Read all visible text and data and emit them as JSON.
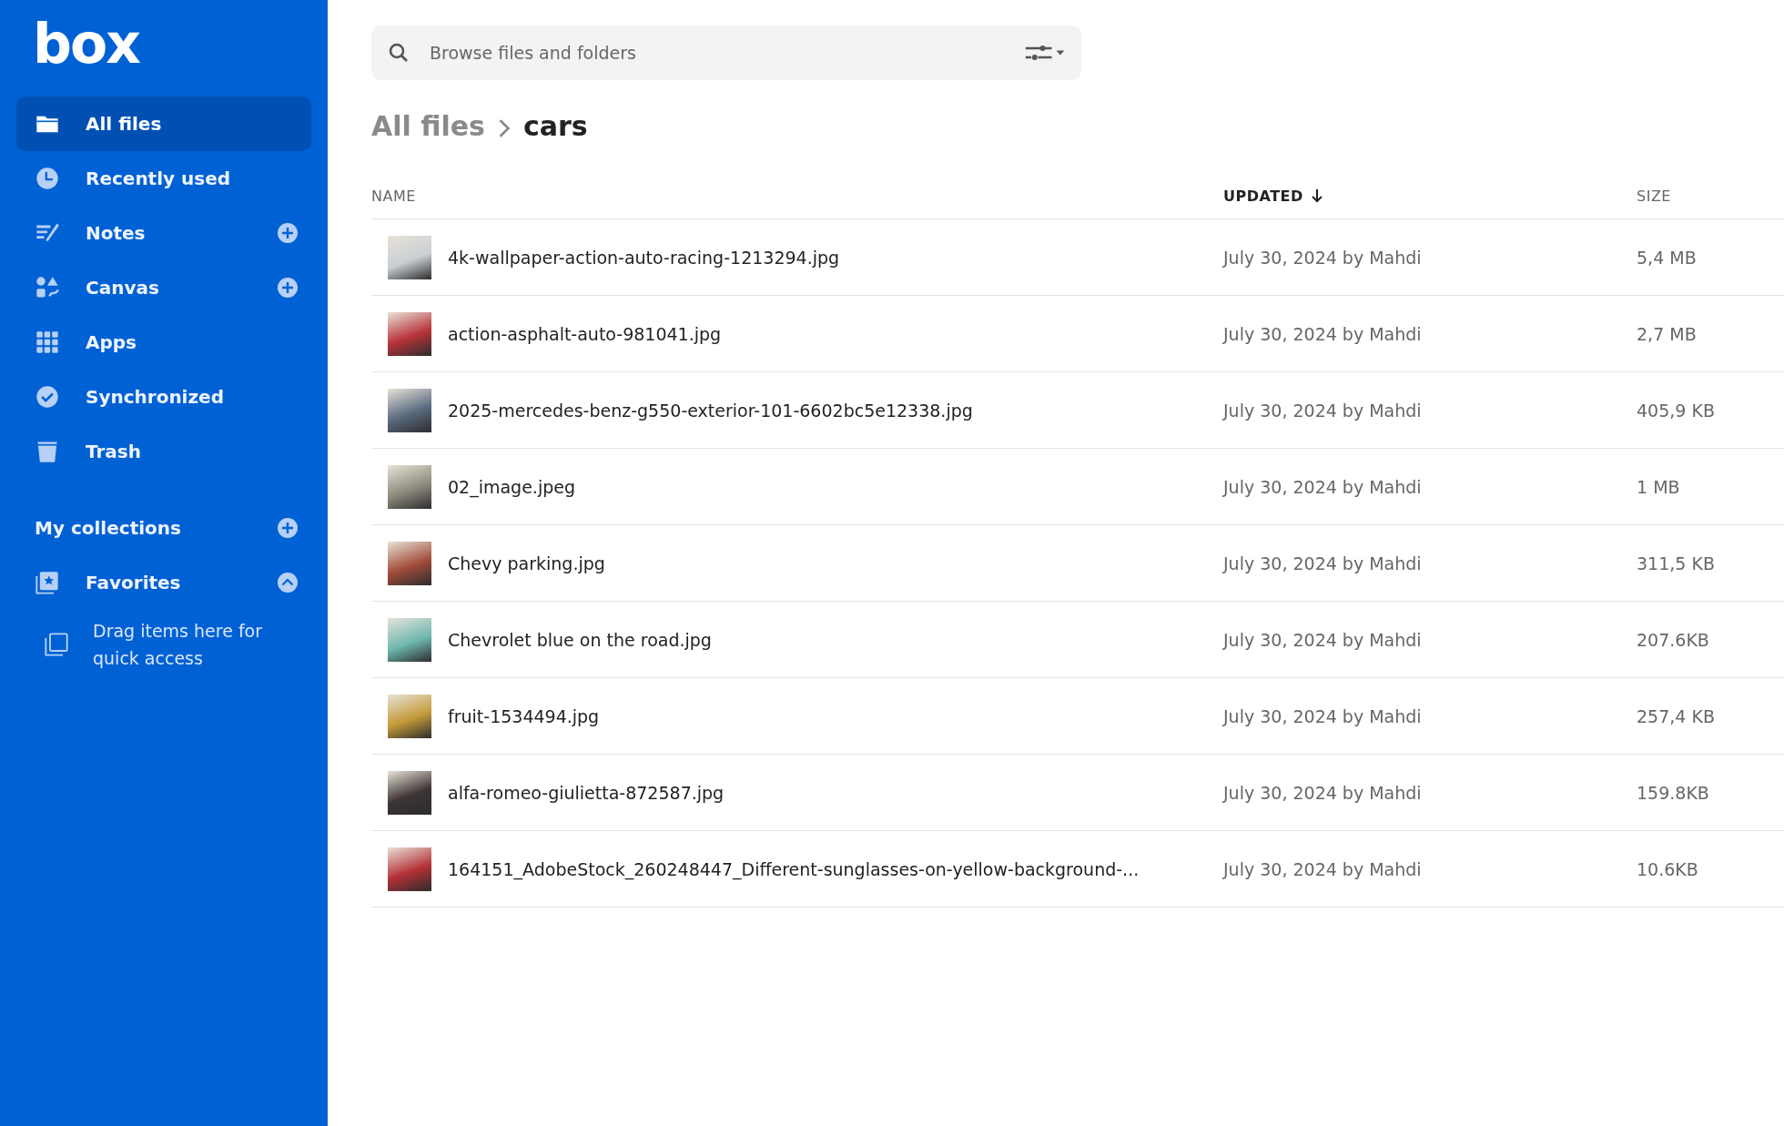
{
  "sidebar": {
    "logo": "box",
    "items": [
      {
        "label": "All files",
        "selected": true,
        "add": false
      },
      {
        "label": "Recently used",
        "selected": false,
        "add": false
      },
      {
        "label": "Notes",
        "selected": false,
        "add": true
      },
      {
        "label": "Canvas",
        "selected": false,
        "add": true
      },
      {
        "label": "Apps",
        "selected": false,
        "add": false
      },
      {
        "label": "Synchronized",
        "selected": false,
        "add": false
      },
      {
        "label": "Trash",
        "selected": false,
        "add": false
      }
    ],
    "collections": {
      "title": "My collections",
      "add": true,
      "favorites": {
        "label": "Favorites",
        "expanded": true,
        "hint": "Drag items here for quick access"
      }
    }
  },
  "search": {
    "placeholder": "Browse files and folders"
  },
  "breadcrumb": [
    "All files",
    "cars"
  ],
  "table": {
    "columns": [
      {
        "label": "NAME",
        "sorted": false
      },
      {
        "label": "UPDATED",
        "sorted": true
      },
      {
        "label": "SIZE",
        "sorted": false
      }
    ],
    "rows": [
      {
        "name": "4k-wallpaper-action-auto-racing-1213294.jpg",
        "updated": "July 30, 2024 by Mahdi",
        "size": "5,4 MB"
      },
      {
        "name": "action-asphalt-auto-981041.jpg",
        "updated": "July 30, 2024 by Mahdi",
        "size": "2,7 MB"
      },
      {
        "name": "2025-mercedes-benz-g550-exterior-101-6602bc5e12338.jpg",
        "updated": "July 30, 2024 by Mahdi",
        "size": "405,9 KB"
      },
      {
        "name": "02_image.jpeg",
        "updated": "July 30, 2024 by Mahdi",
        "size": "1 MB"
      },
      {
        "name": "Chevy parking.jpg",
        "updated": "July 30, 2024 by Mahdi",
        "size": "311,5 KB"
      },
      {
        "name": "Chevrolet blue on the road.jpg",
        "updated": "July 30, 2024 by Mahdi",
        "size": "207.6KB"
      },
      {
        "name": "fruit-1534494.jpg",
        "updated": "July 30, 2024 by Mahdi",
        "size": "257,4 KB"
      },
      {
        "name": "alfa-romeo-giulietta-872587.jpg",
        "updated": "July 30, 2024 by Mahdi",
        "size": "159.8KB"
      },
      {
        "name": "164151_AdobeStock_260248447_Different-sunglasses-on-yellow-background-...",
        "updated": "July 30, 2024 by Mahdi",
        "size": "10.6KB"
      }
    ]
  }
}
